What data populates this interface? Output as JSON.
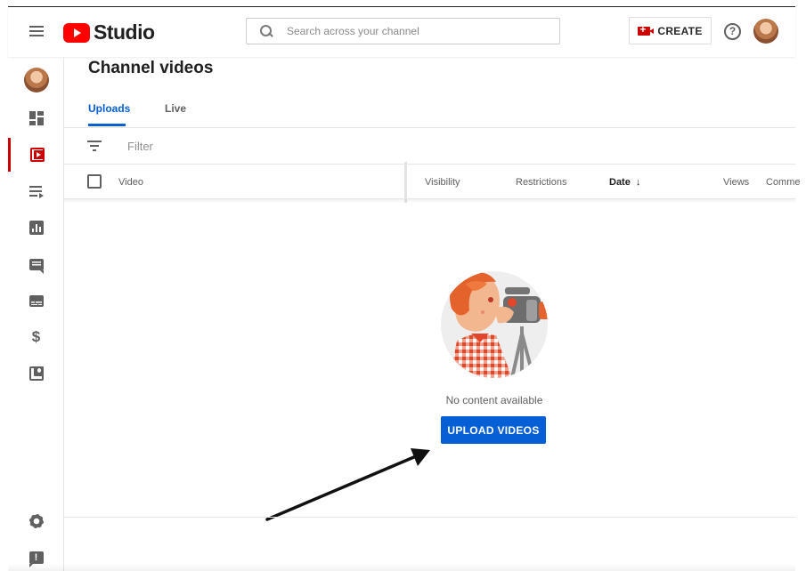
{
  "header": {
    "brand_text": "Studio",
    "search_placeholder": "Search across your channel",
    "create_label": "CREATE",
    "help_glyph": "?"
  },
  "sidebar": {
    "items": [
      {
        "name": "dashboard",
        "icon": "dashboard-icon"
      },
      {
        "name": "videos",
        "icon": "video-play-icon",
        "active": true
      },
      {
        "name": "playlists",
        "icon": "playlist-icon"
      },
      {
        "name": "analytics",
        "icon": "analytics-icon"
      },
      {
        "name": "comments",
        "icon": "comments-icon"
      },
      {
        "name": "subtitles",
        "icon": "subtitles-icon"
      },
      {
        "name": "monetization",
        "icon": "dollar-icon",
        "glyph": "$"
      },
      {
        "name": "audio-library",
        "icon": "audio-library-icon"
      }
    ],
    "bottom_items": [
      {
        "name": "settings",
        "icon": "gear-icon"
      },
      {
        "name": "feedback",
        "icon": "feedback-icon",
        "glyph": "!"
      }
    ]
  },
  "main": {
    "title": "Channel videos",
    "tabs": [
      {
        "label": "Uploads",
        "active": true
      },
      {
        "label": "Live",
        "active": false
      }
    ],
    "filter_label": "Filter",
    "columns": {
      "video": "Video",
      "visibility": "Visibility",
      "restrictions": "Restrictions",
      "date": "Date",
      "date_sort_glyph": "↓",
      "views": "Views",
      "comments": "Comme"
    },
    "empty_state": {
      "message": "No content available",
      "button_label": "UPLOAD VIDEOS"
    }
  },
  "colors": {
    "brand_red": "#ff0000",
    "accent_blue": "#065fd4",
    "active_nav": "#cc0000"
  }
}
